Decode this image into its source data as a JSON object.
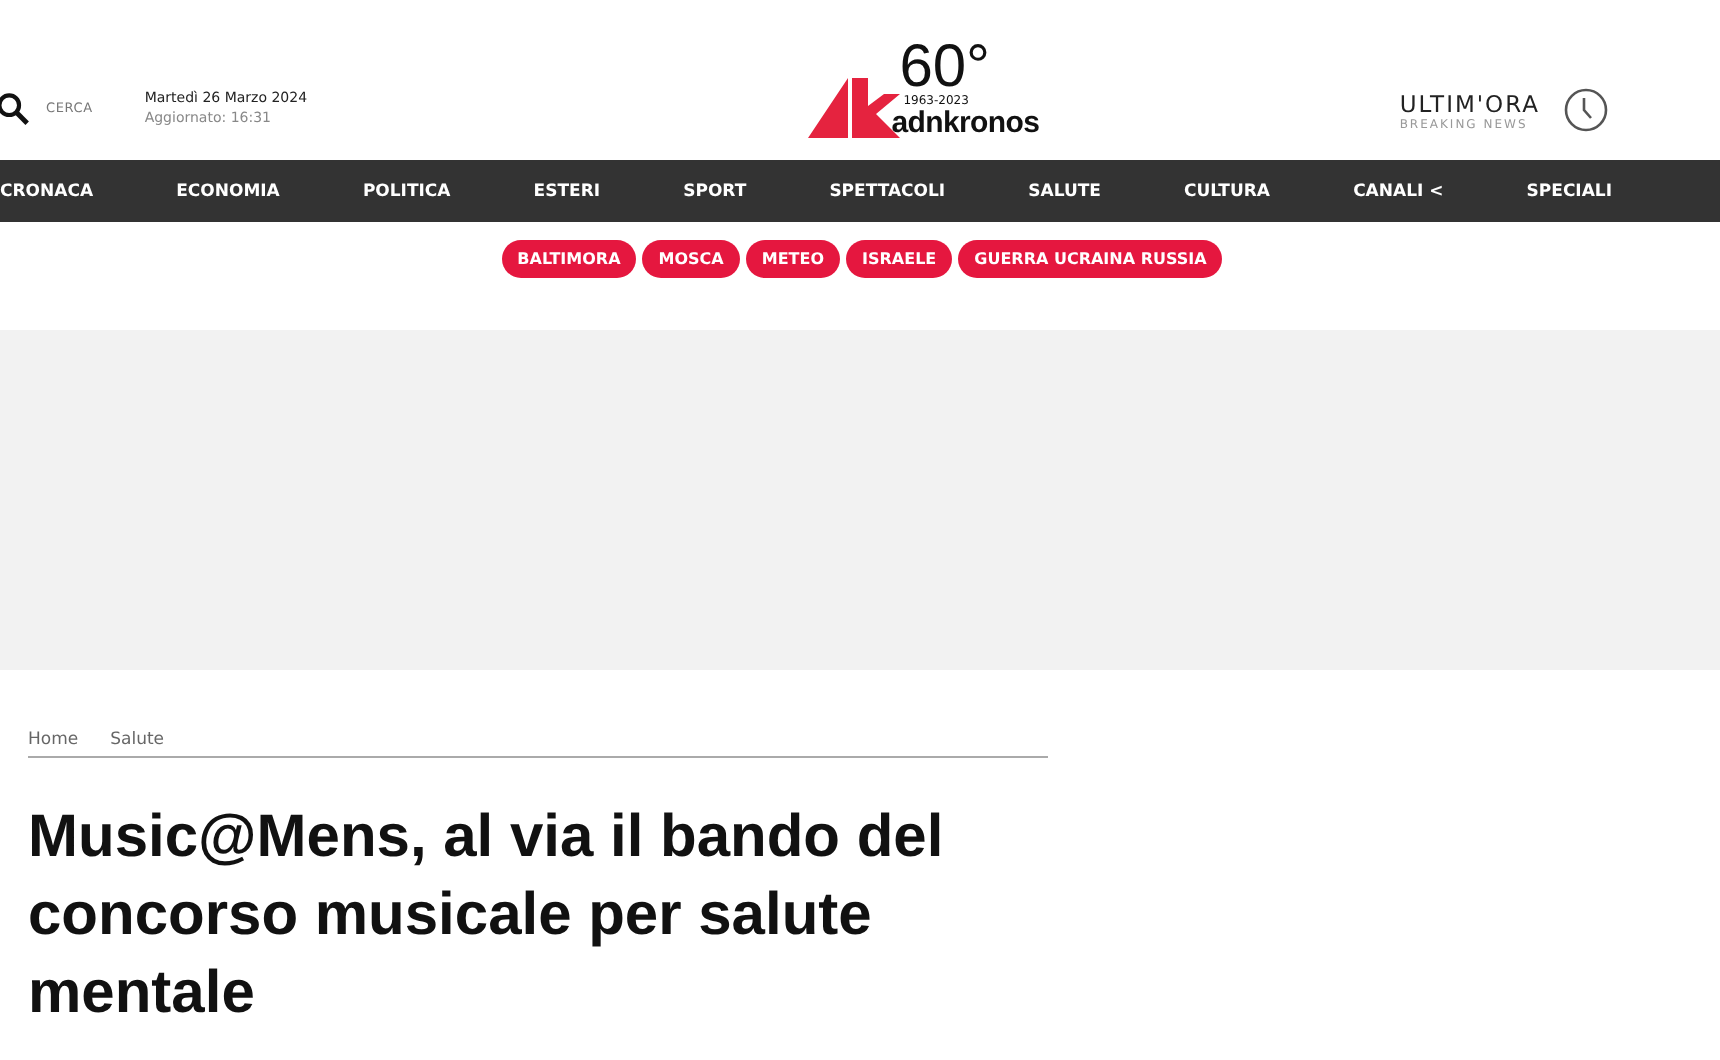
{
  "header": {
    "search_label": "CERCA",
    "date": "Martedì 26 Marzo 2024",
    "updated": "Aggiornato: 16:31",
    "logo": {
      "anniversary": "60°",
      "years": "1963-2023",
      "brand": "adnkronos"
    },
    "breaking": {
      "title": "ULTIM'ORA",
      "subtitle": "BREAKING NEWS"
    }
  },
  "nav": [
    "CRONACA",
    "ECONOMIA",
    "POLITICA",
    "ESTERI",
    "SPORT",
    "SPETTACOLI",
    "SALUTE",
    "CULTURA",
    "CANALI <",
    "SPECIALI"
  ],
  "tags": [
    "BALTIMORA",
    "MOSCA",
    "METEO",
    "ISRAELE",
    "GUERRA UCRAINA RUSSIA"
  ],
  "breadcrumb": [
    "Home",
    "Salute"
  ],
  "article": {
    "title": "Music@Mens, al via il bando del concorso musicale per salute mentale"
  }
}
